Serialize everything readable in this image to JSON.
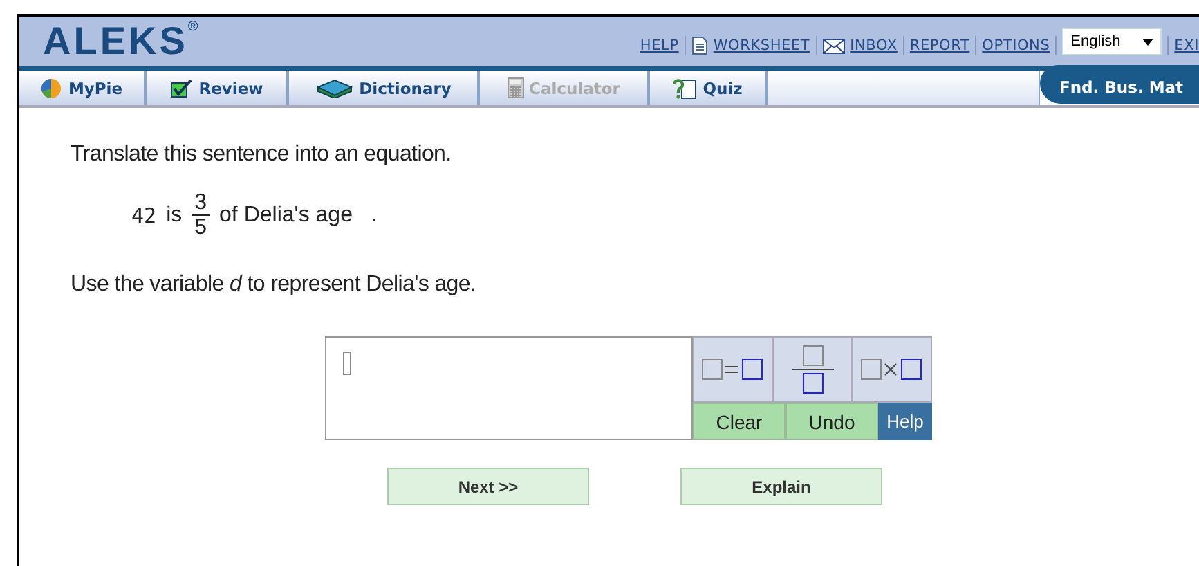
{
  "header": {
    "logo": "ALEKS",
    "logo_mark": "®",
    "links": [
      {
        "label": "HELP",
        "kind": "plain"
      },
      {
        "label": "WORKSHEET",
        "kind": "worksheet"
      },
      {
        "label": "INBOX",
        "kind": "inbox"
      },
      {
        "label": "REPORT",
        "kind": "plain"
      },
      {
        "label": "OPTIONS",
        "kind": "plain"
      }
    ],
    "language": "English",
    "exit": "EXI"
  },
  "tabs": [
    {
      "label": "MyPie",
      "kind": "pie",
      "disabled": false
    },
    {
      "label": "Review",
      "kind": "review",
      "disabled": false
    },
    {
      "label": "Dictionary",
      "kind": "book",
      "disabled": false
    },
    {
      "label": "Calculator",
      "kind": "calculator",
      "disabled": true
    },
    {
      "label": "Quiz",
      "kind": "quiz",
      "disabled": false
    }
  ],
  "course": "Fnd. Bus. Mat",
  "question": {
    "instruction": "Translate this sentence into an equation.",
    "statement": {
      "number": "42",
      "verb": "is",
      "numerator": "3",
      "denominator": "5",
      "rest": "of Delia's age",
      "end": "."
    },
    "variable_note": "Use the variable *d* to represent Delia's age."
  },
  "answer": {
    "tools": [
      {
        "kind": "equals"
      },
      {
        "kind": "fraction"
      },
      {
        "kind": "times"
      }
    ],
    "actions": [
      {
        "label": "Clear",
        "kind": "green"
      },
      {
        "label": "Undo",
        "kind": "green"
      },
      {
        "label": "Help",
        "kind": "blue"
      }
    ]
  },
  "buttons": [
    "Next >>",
    "Explain"
  ]
}
